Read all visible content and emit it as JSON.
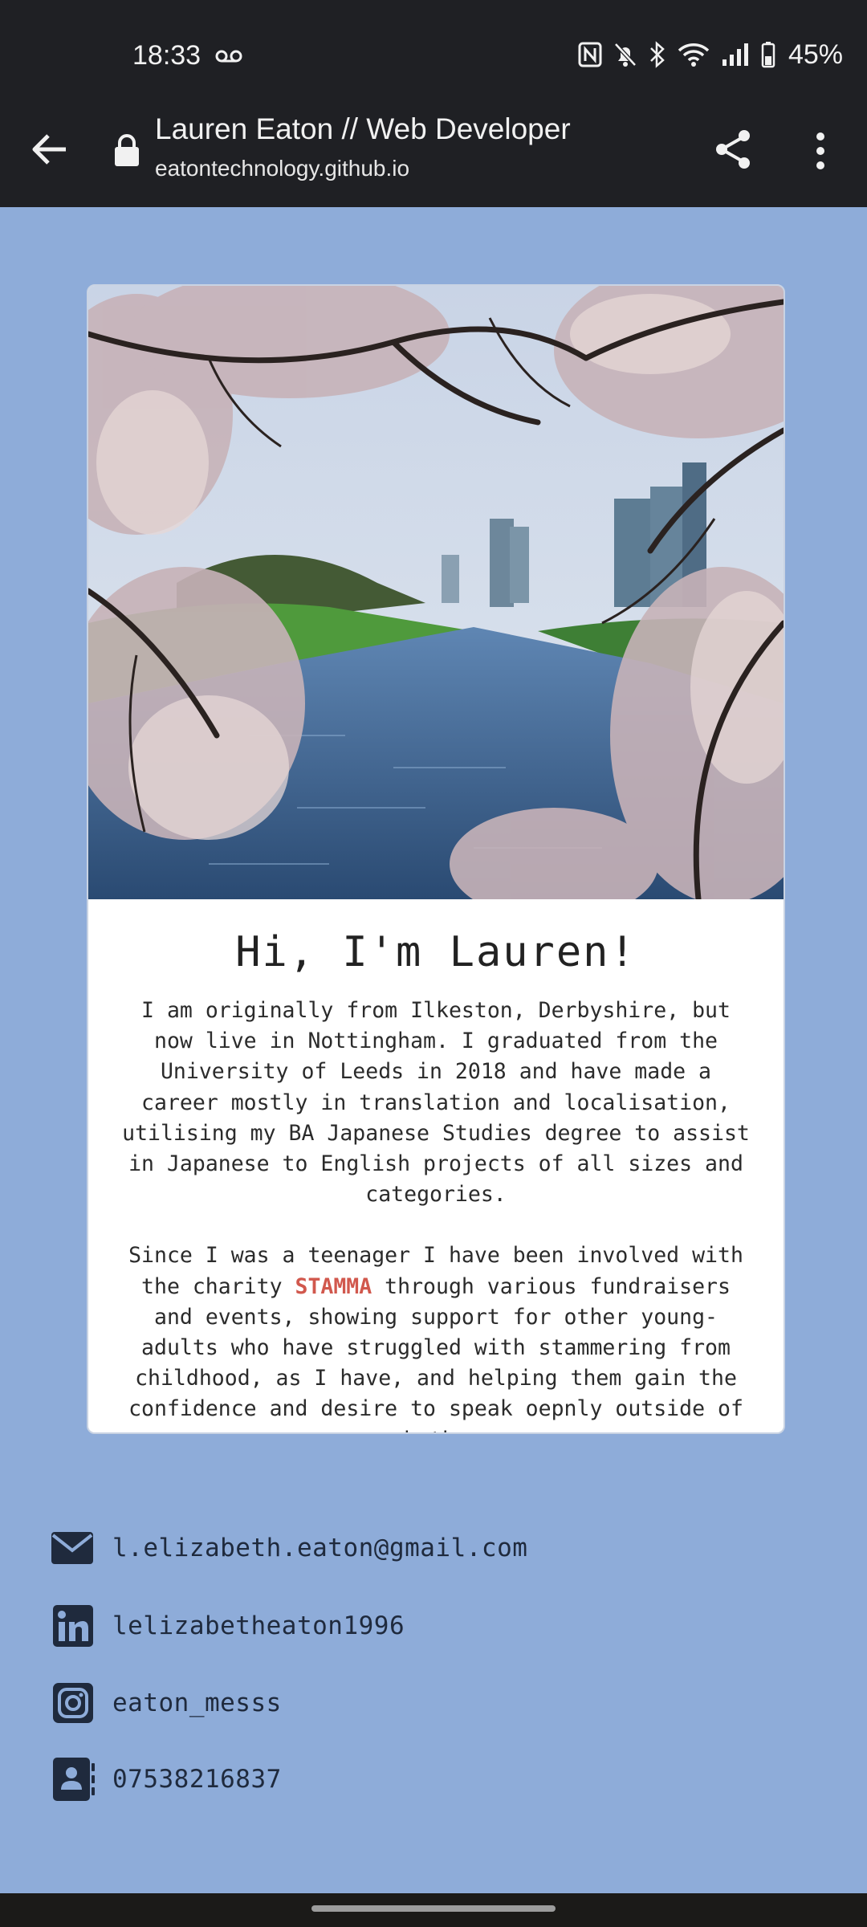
{
  "status_bar": {
    "time": "18:33",
    "battery": "45%"
  },
  "browser": {
    "page_title": "Lauren Eaton // Web Developer",
    "url": "eatontechnology.github.io"
  },
  "card": {
    "heading": "Hi, I'm Lauren!",
    "paragraph1": "I am originally from Ilkeston, Derbyshire, but now live in Nottingham. I graduated from the University of Leeds in 2018 and have made a career mostly in translation and localisation, utilising my BA Japanese Studies degree to assist in Japanese to English projects of all sizes and categories.",
    "paragraph2_before": "Since I was a teenager I have been involved with the charity ",
    "paragraph2_link": "STAMMA",
    "paragraph2_after": " through various fundraisers and events, showing support for other young-adults who have struggled with stammering from childhood, as I have, and helping them gain the confidence and desire to speak oepnly outside of speech therapy."
  },
  "contacts": {
    "email": "l.elizabeth.eaton@gmail.com",
    "linkedin": "lelizabetheaton1996",
    "instagram": "eaton_messs",
    "phone": "07538216837"
  },
  "colors": {
    "page_bg": "#8eacd9",
    "toolbar_bg": "#1f2024",
    "accent_link": "#d1584d",
    "icon": "#1f2a3d"
  }
}
